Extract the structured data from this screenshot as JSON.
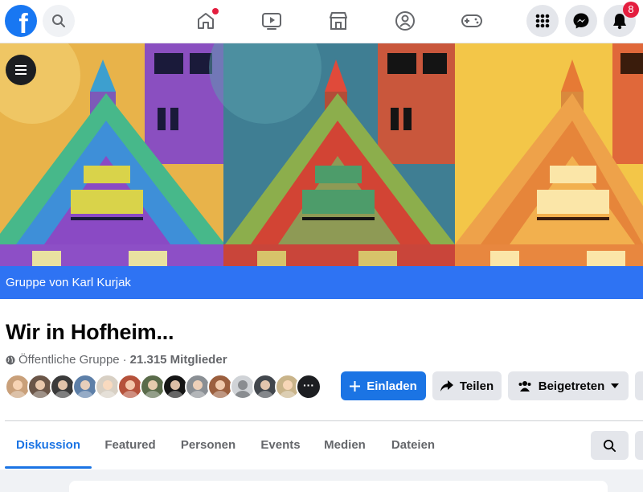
{
  "topbar": {
    "logo_letter": "f",
    "notifications_badge": "8",
    "icons": [
      "facebook-logo",
      "search-icon",
      "home-icon",
      "watch-icon",
      "marketplace-icon",
      "groups-icon",
      "gaming-icon",
      "menu-grid-icon",
      "messenger-icon",
      "bell-icon"
    ]
  },
  "cover": {
    "panel_colors": [
      "#e7b43f",
      "#3d7f9a",
      "#f2c43e"
    ]
  },
  "group": {
    "banner_text": "Gruppe von Karl Kurjak",
    "title": "Wir in Hofheim...",
    "privacy": "Öffentliche Gruppe",
    "separator": "·",
    "members": "21.315 Mitglieder",
    "more_members_label": "···"
  },
  "actions": {
    "invite": "Einladen",
    "share": "Teilen",
    "joined": "Beigetreten"
  },
  "tabs": [
    {
      "label": "Diskussion",
      "active": true
    },
    {
      "label": "Featured",
      "active": false
    },
    {
      "label": "Personen",
      "active": false
    },
    {
      "label": "Events",
      "active": false
    },
    {
      "label": "Medien",
      "active": false
    },
    {
      "label": "Dateien",
      "active": false
    }
  ],
  "colors": {
    "accent": "#1b74e4",
    "banner": "#2e73f3",
    "badge": "#e41e3f"
  }
}
